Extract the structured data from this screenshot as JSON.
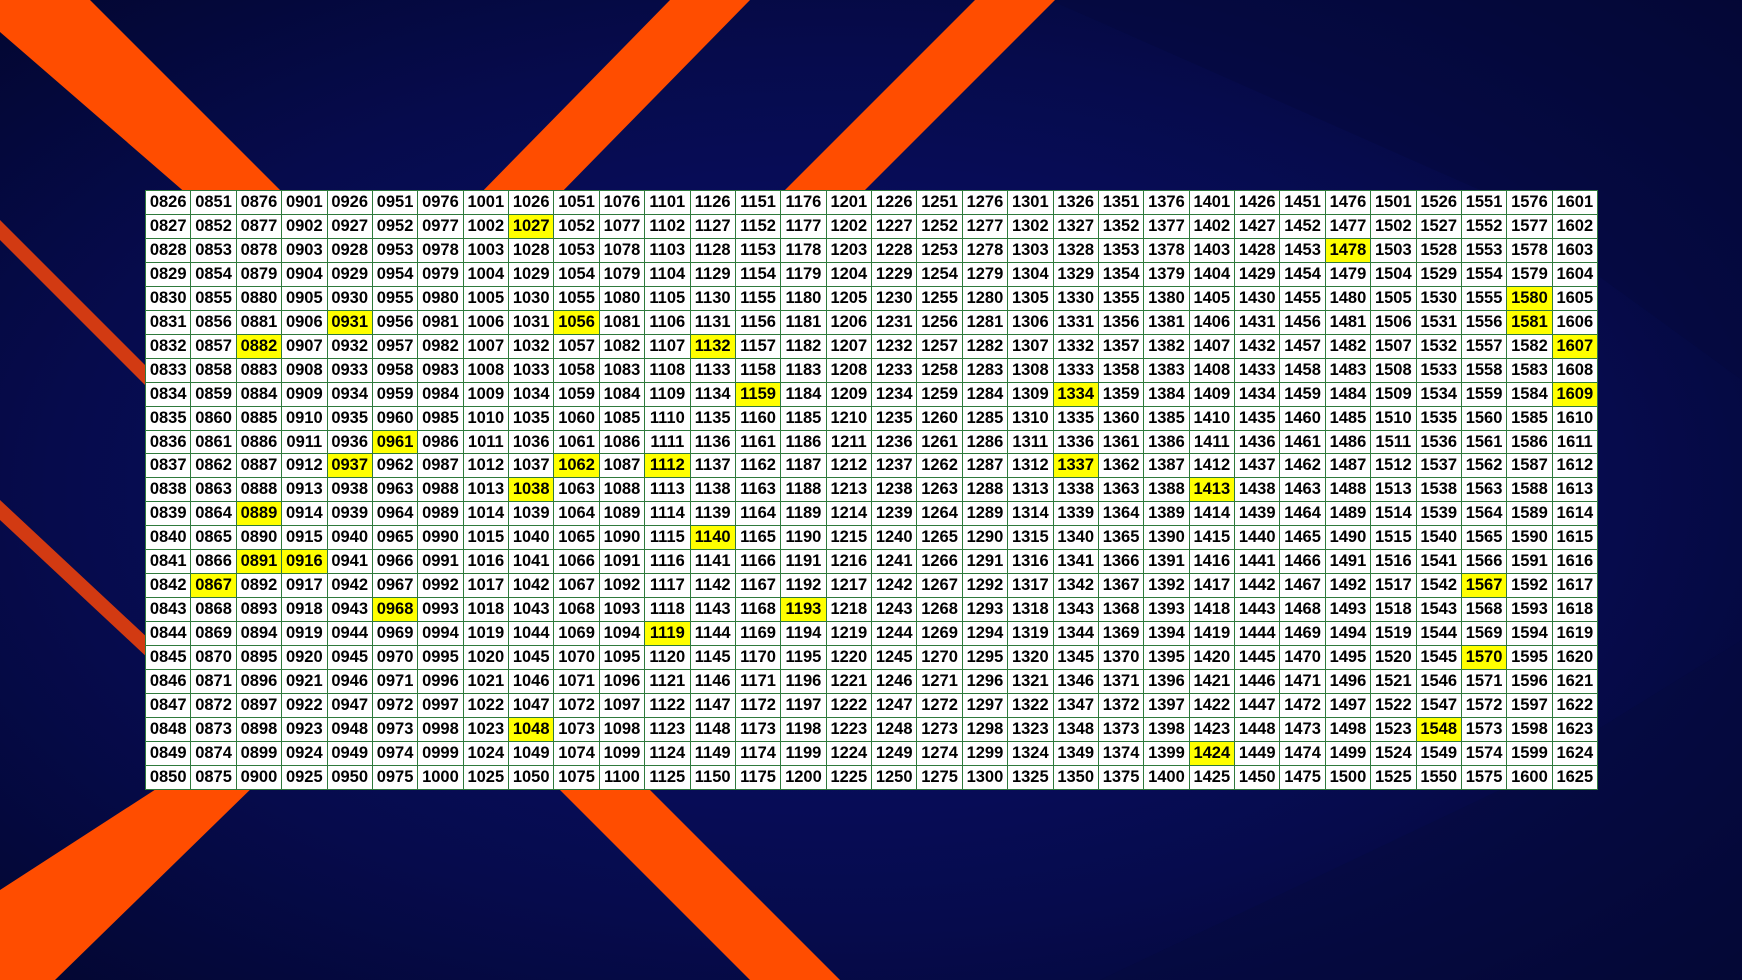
{
  "colors": {
    "background_navy": "#0a0f5a",
    "background_dark": "#020530",
    "stripe_orange": "#ff4d00",
    "highlight_yellow": "#ffff00",
    "cell_border_green": "#2f7a3c"
  },
  "grid": {
    "start_number": 826,
    "rows": 25,
    "columns": 32,
    "column_step": 25,
    "row_step": 1,
    "digits": 4,
    "highlighted_cells": [
      [
        1,
        8
      ],
      [
        2,
        26
      ],
      [
        4,
        30
      ],
      [
        5,
        4
      ],
      [
        5,
        9
      ],
      [
        5,
        30
      ],
      [
        6,
        2
      ],
      [
        6,
        12
      ],
      [
        6,
        31
      ],
      [
        8,
        13
      ],
      [
        8,
        20
      ],
      [
        8,
        31
      ],
      [
        10,
        5
      ],
      [
        11,
        4
      ],
      [
        11,
        9
      ],
      [
        11,
        11
      ],
      [
        11,
        20
      ],
      [
        12,
        8
      ],
      [
        12,
        23
      ],
      [
        13,
        2
      ],
      [
        14,
        12
      ],
      [
        15,
        2
      ],
      [
        15,
        3
      ],
      [
        16,
        1
      ],
      [
        16,
        29
      ],
      [
        17,
        5
      ],
      [
        17,
        14
      ],
      [
        18,
        11
      ],
      [
        19,
        29
      ],
      [
        22,
        8
      ],
      [
        22,
        28
      ],
      [
        23,
        23
      ]
    ]
  }
}
